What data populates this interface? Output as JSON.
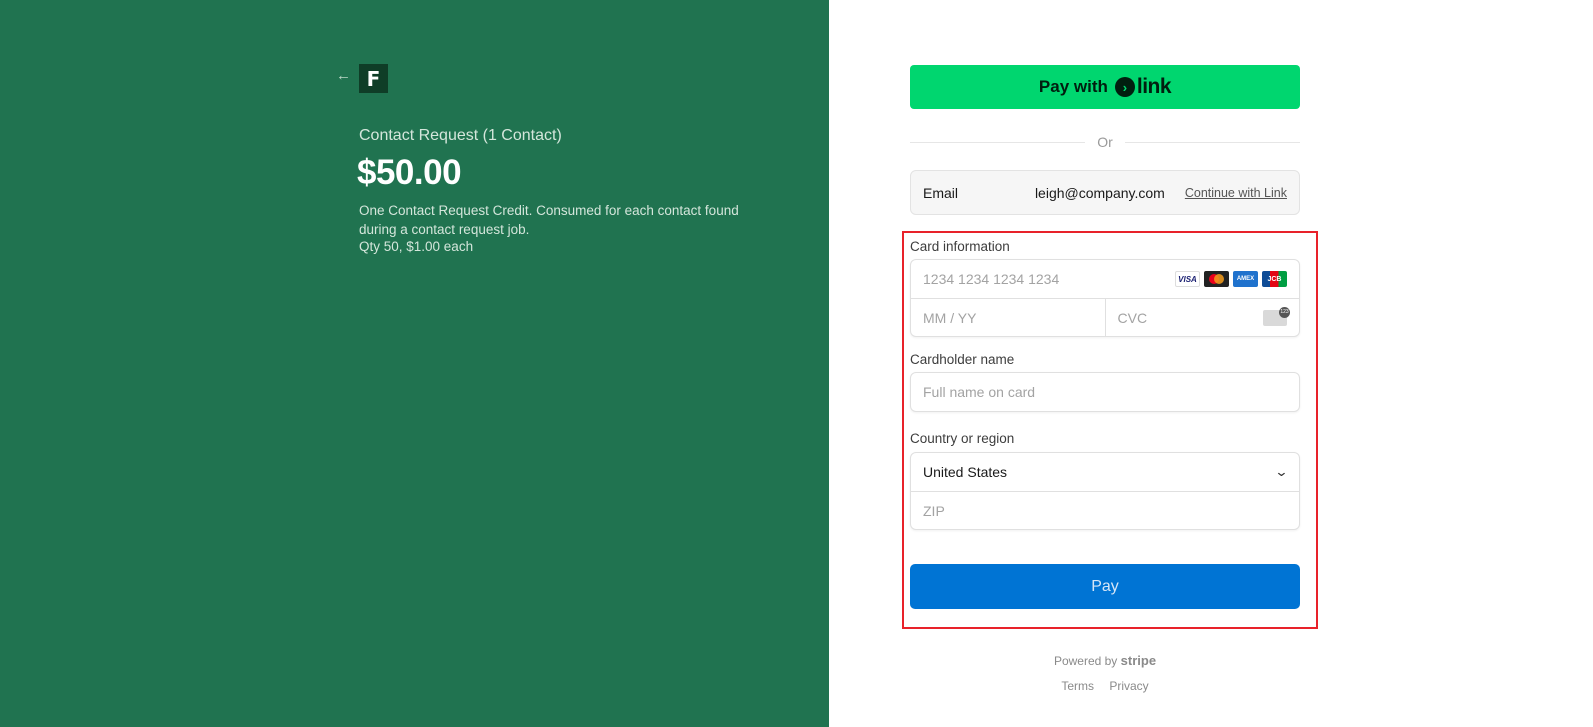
{
  "merchant": {
    "back_arrow": "←",
    "logo_letter": "F"
  },
  "product": {
    "name": "Contact Request (1 Contact)",
    "price": "$50.00",
    "description": "One Contact Request Credit. Consumed for each contact found during a contact request job.",
    "quantity_text": "Qty 50, $1.00 each"
  },
  "link_button": {
    "prefix": "Pay with",
    "brand_word": "link",
    "brand_icon": "›"
  },
  "divider_text": "Or",
  "email": {
    "label": "Email",
    "value": "leigh@company.com",
    "link_label": "Continue with Link"
  },
  "card": {
    "label": "Card information",
    "number_placeholder": "1234 1234 1234 1234",
    "expiry_placeholder": "MM / YY",
    "cvc_placeholder": "CVC",
    "brands": [
      "VISA",
      "",
      "AMEX",
      "JCB"
    ]
  },
  "cardholder": {
    "label": "Cardholder name",
    "placeholder": "Full name on card"
  },
  "country": {
    "label": "Country or region",
    "selected": "United States",
    "zip_placeholder": "ZIP"
  },
  "pay_button": "Pay",
  "footer": {
    "powered_by": "Powered by",
    "stripe": "stripe",
    "terms": "Terms",
    "privacy": "Privacy"
  },
  "colors": {
    "left_panel": "#207350",
    "link_green": "#00d66f",
    "pay_blue": "#0074d4",
    "highlight_red": "#e8222a"
  }
}
